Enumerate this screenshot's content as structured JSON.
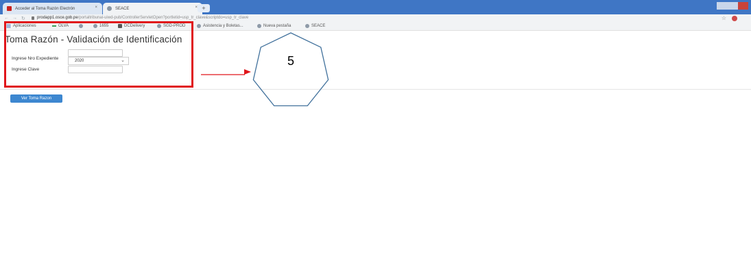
{
  "browser": {
    "tabs": [
      {
        "title": "Acceder al Toma Razón Electrón"
      },
      {
        "title": "SEACE"
      }
    ],
    "new_tab_label": "+",
    "close_glyph": "×",
    "address_bar": {
      "host": "prodapp1.osce.gob.pe",
      "path": "/portaltribunal-uiwd-pub/ControllerServletOpen?portletid=usp_tr_clave&scriptdo=usp_tr_clave"
    },
    "bookmarks": [
      {
        "label": "Aplicaciones",
        "icon": "apps-grid-icon"
      },
      {
        "label": "OLVA",
        "icon": "dash-icon"
      },
      {
        "label": "",
        "icon": "globe-icon"
      },
      {
        "label": "1655",
        "icon": "globe-icon"
      },
      {
        "label": "DCDelivery",
        "icon": "square-icon"
      },
      {
        "label": "SGD-PROD",
        "icon": "globe-icon"
      },
      {
        "label": "Asistencia y Boletas...",
        "icon": "globe-icon"
      },
      {
        "label": "Nueva pestaña",
        "icon": "globe-icon"
      },
      {
        "label": "SEACE",
        "icon": "globe-icon"
      }
    ]
  },
  "page": {
    "title": "Toma Razón - Validación de Identificación",
    "form": {
      "expediente_label": "Ingrese Nro Expediente",
      "expediente_value": "",
      "year_value": "2020",
      "clave_label": "Ingrese Clave",
      "clave_value": ""
    },
    "submit_label": "Ver Toma Razon"
  },
  "annotation": {
    "step_number": "5",
    "highlight_color": "#e0151a",
    "heptagon_color": "#41719c"
  }
}
